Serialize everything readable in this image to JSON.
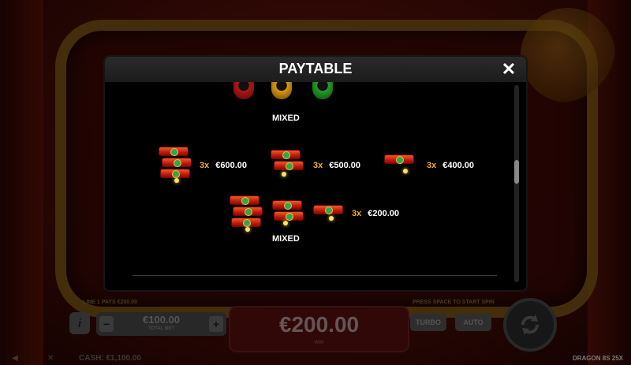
{
  "modal": {
    "title": "PAYTABLE",
    "close_icon": "close-icon"
  },
  "bell_section": {
    "colors": [
      "#b01818",
      "#d89a10",
      "#2a9a2a"
    ],
    "label": "MIXED"
  },
  "firecracker_pays": [
    {
      "count": 3,
      "multiplier": "3x",
      "payout": "€600.00"
    },
    {
      "count": 2,
      "multiplier": "3x",
      "payout": "€500.00"
    },
    {
      "count": 1,
      "multiplier": "3x",
      "payout": "€400.00"
    }
  ],
  "mixed_firecracker": {
    "multiplier": "3x",
    "payout": "€200.00",
    "label": "MIXED"
  },
  "bottom": {
    "line_info": "LINE 1 PAYS €200.00",
    "feature_info": "PRESS SPACE TO START SPIN",
    "info_label": "i",
    "bet_value": "€100.00",
    "bet_label": "TOTAL BET",
    "minus": "−",
    "plus": "+",
    "win_value": "€200.00",
    "win_label": "WIN",
    "turbo_label": "TURBO",
    "auto_label": "AUTO",
    "cash": "CASH: €1,100.00",
    "game_name": "DRAGON 8S 25X"
  }
}
